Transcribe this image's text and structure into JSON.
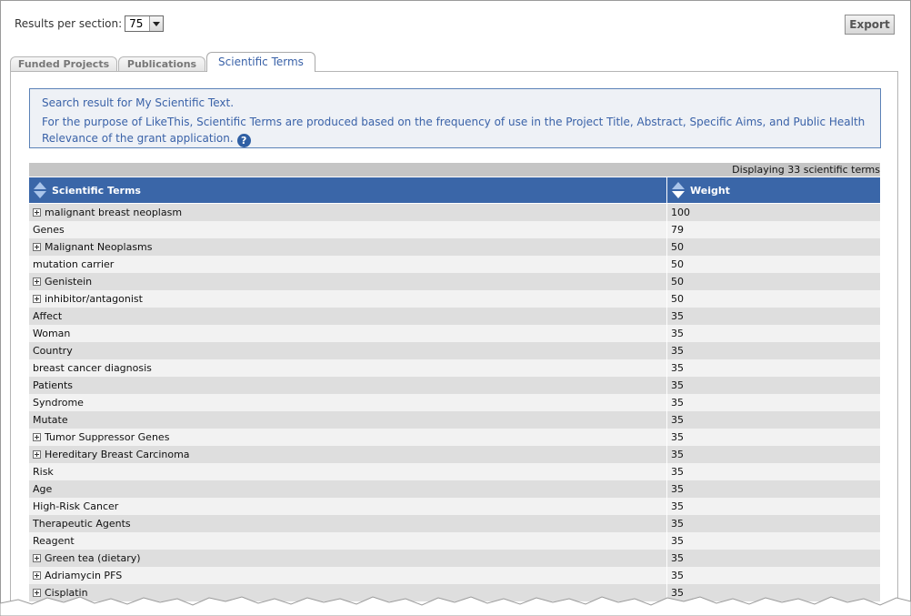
{
  "controls": {
    "results_per_section_label": "Results per section:",
    "results_per_section_value": "75",
    "export_label": "Export"
  },
  "tabs": [
    {
      "label": "Funded Projects",
      "active": false
    },
    {
      "label": "Publications",
      "active": false
    },
    {
      "label": "Scientific Terms",
      "active": true
    }
  ],
  "info": {
    "line1": "Search result for My Scientific Text.",
    "line2": "For the purpose of LikeThis, Scientific Terms are produced based on the frequency of use in the Project Title, Abstract, Specific Aims, and Public Health Relevance of the grant application."
  },
  "table": {
    "displaying": "Displaying 33 scientific terms",
    "headers": {
      "term": "Scientific Terms",
      "weight": "Weight"
    },
    "rows": [
      {
        "term": "malignant breast neoplasm",
        "weight": "100",
        "expandable": true
      },
      {
        "term": "Genes",
        "weight": "79",
        "expandable": false
      },
      {
        "term": "Malignant Neoplasms",
        "weight": "50",
        "expandable": true
      },
      {
        "term": "mutation carrier",
        "weight": "50",
        "expandable": false
      },
      {
        "term": "Genistein",
        "weight": "50",
        "expandable": true
      },
      {
        "term": "inhibitor/antagonist",
        "weight": "50",
        "expandable": true
      },
      {
        "term": "Affect",
        "weight": "35",
        "expandable": false
      },
      {
        "term": "Woman",
        "weight": "35",
        "expandable": false
      },
      {
        "term": "Country",
        "weight": "35",
        "expandable": false
      },
      {
        "term": "breast cancer diagnosis",
        "weight": "35",
        "expandable": false
      },
      {
        "term": "Patients",
        "weight": "35",
        "expandable": false
      },
      {
        "term": "Syndrome",
        "weight": "35",
        "expandable": false
      },
      {
        "term": "Mutate",
        "weight": "35",
        "expandable": false
      },
      {
        "term": "Tumor Suppressor Genes",
        "weight": "35",
        "expandable": true
      },
      {
        "term": "Hereditary Breast Carcinoma",
        "weight": "35",
        "expandable": true
      },
      {
        "term": "Risk",
        "weight": "35",
        "expandable": false
      },
      {
        "term": "Age",
        "weight": "35",
        "expandable": false
      },
      {
        "term": "High-Risk Cancer",
        "weight": "35",
        "expandable": false
      },
      {
        "term": "Therapeutic Agents",
        "weight": "35",
        "expandable": false
      },
      {
        "term": "Reagent",
        "weight": "35",
        "expandable": false
      },
      {
        "term": "Green tea (dietary)",
        "weight": "35",
        "expandable": true
      },
      {
        "term": "Adriamycin PFS",
        "weight": "35",
        "expandable": true
      },
      {
        "term": "Cisplatin",
        "weight": "35",
        "expandable": true
      }
    ]
  }
}
